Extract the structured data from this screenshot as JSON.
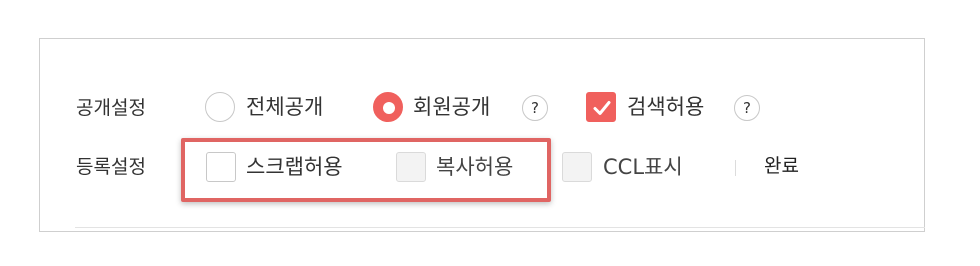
{
  "public_settings": {
    "label": "공개설정",
    "options": [
      {
        "label": "전체공개",
        "selected": false
      },
      {
        "label": "회원공개",
        "selected": true
      }
    ],
    "help_label": "?",
    "search_allow": {
      "label": "검색허용",
      "checked": true
    },
    "search_help_label": "?"
  },
  "register_settings": {
    "label": "등록설정",
    "options": [
      {
        "label": "스크랩허용",
        "checked": false,
        "enabled": true
      },
      {
        "label": "복사허용",
        "checked": false,
        "enabled": false
      },
      {
        "label": "CCL표시",
        "checked": false,
        "enabled": false
      }
    ],
    "done_label": "완료"
  },
  "colors": {
    "accent": "#f0605d",
    "highlight": "#e06563"
  }
}
